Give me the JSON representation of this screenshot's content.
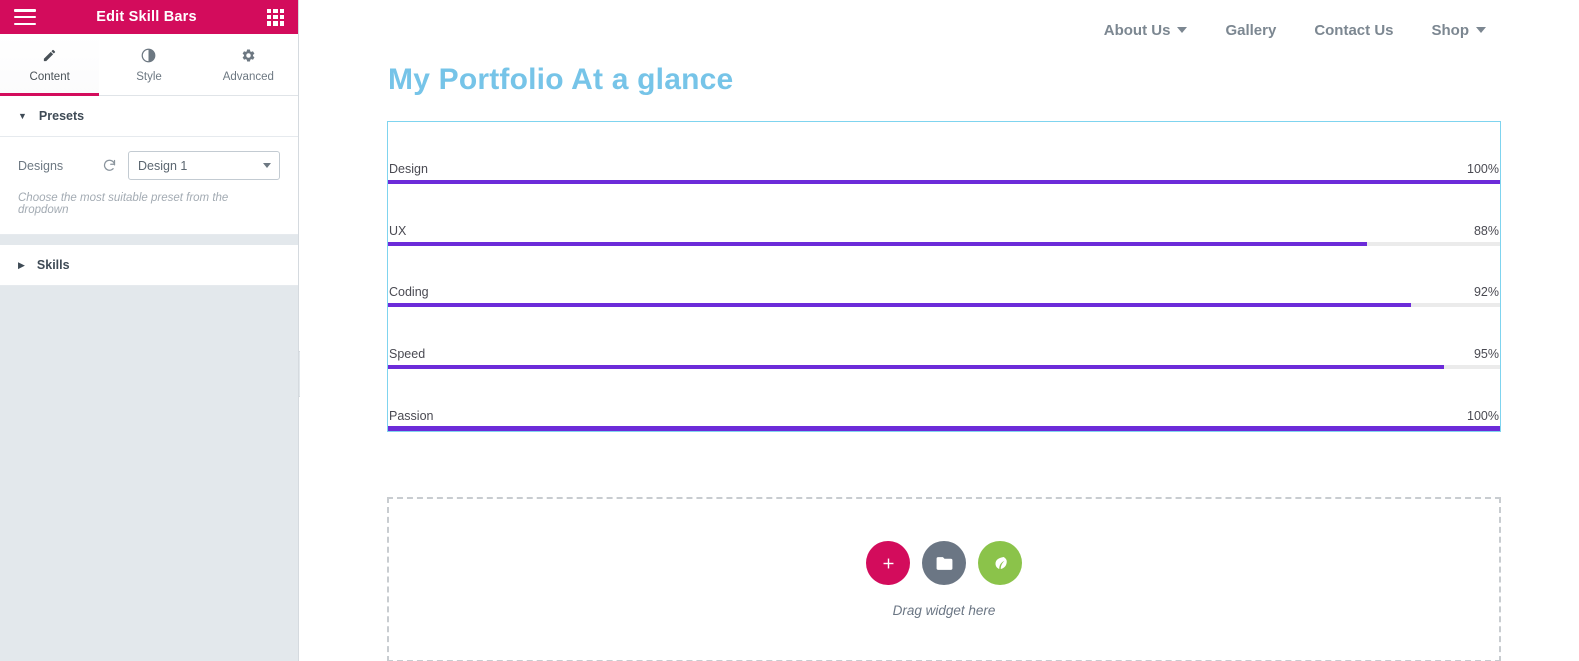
{
  "panel": {
    "header": {
      "title": "Edit Skill Bars",
      "menu_icon": "hamburger-menu-icon",
      "grid_icon": "widgets-grid-icon"
    },
    "tabs": [
      {
        "label": "Content",
        "icon": "pencil-icon",
        "active": true
      },
      {
        "label": "Style",
        "icon": "contrast-icon",
        "active": false
      },
      {
        "label": "Advanced",
        "icon": "gear-icon",
        "active": false
      }
    ],
    "sections": [
      {
        "label": "Presets",
        "expanded": true
      },
      {
        "label": "Skills",
        "expanded": false
      }
    ],
    "presets": {
      "designs_label": "Designs",
      "refresh_icon": "refresh-icon",
      "select_value": "Design 1",
      "select_options": [
        "Design 1"
      ],
      "hint": "Choose the most suitable preset from the dropdown"
    },
    "collapse_handle_icon": "chevron-left-icon"
  },
  "preview": {
    "nav": [
      {
        "label": "About Us",
        "has_dropdown": true
      },
      {
        "label": "Gallery",
        "has_dropdown": false
      },
      {
        "label": "Contact Us",
        "has_dropdown": false
      },
      {
        "label": "Shop",
        "has_dropdown": true
      }
    ],
    "page_title": "My Portfolio At a glance",
    "skills": [
      {
        "name": "Design",
        "percent_label": "100%",
        "percent": 100
      },
      {
        "name": "UX",
        "percent_label": "88%",
        "percent": 88
      },
      {
        "name": "Coding",
        "percent_label": "92%",
        "percent": 92
      },
      {
        "name": "Speed",
        "percent_label": "95%",
        "percent": 95
      },
      {
        "name": "Passion",
        "percent_label": "100%",
        "percent": 100
      }
    ],
    "drop_zone": {
      "label": "Drag widget here",
      "buttons": [
        {
          "icon": "plus-icon",
          "name": "add-element-button"
        },
        {
          "icon": "folder-icon",
          "name": "add-template-button"
        },
        {
          "icon": "leaf-icon",
          "name": "add-addon-button"
        }
      ]
    }
  },
  "colors": {
    "brand_pink": "#d30c5c",
    "bar_fill": "#6c2bd9",
    "bar_track": "#ebebeb",
    "title_blue": "#76c4e8",
    "selection_outline": "#7fd4ef"
  }
}
